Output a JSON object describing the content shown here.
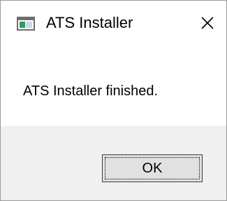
{
  "window": {
    "title": "ATS Installer",
    "app_icon": "application-window-icon",
    "close_icon": "close-x-icon"
  },
  "message": {
    "text": "ATS Installer finished."
  },
  "buttons": {
    "ok_label": "OK"
  },
  "colors": {
    "background": "#ffffff",
    "footer_background": "#f0f0f0",
    "button_face": "#e1e1e1",
    "icon_accent": "#2f9e63"
  }
}
